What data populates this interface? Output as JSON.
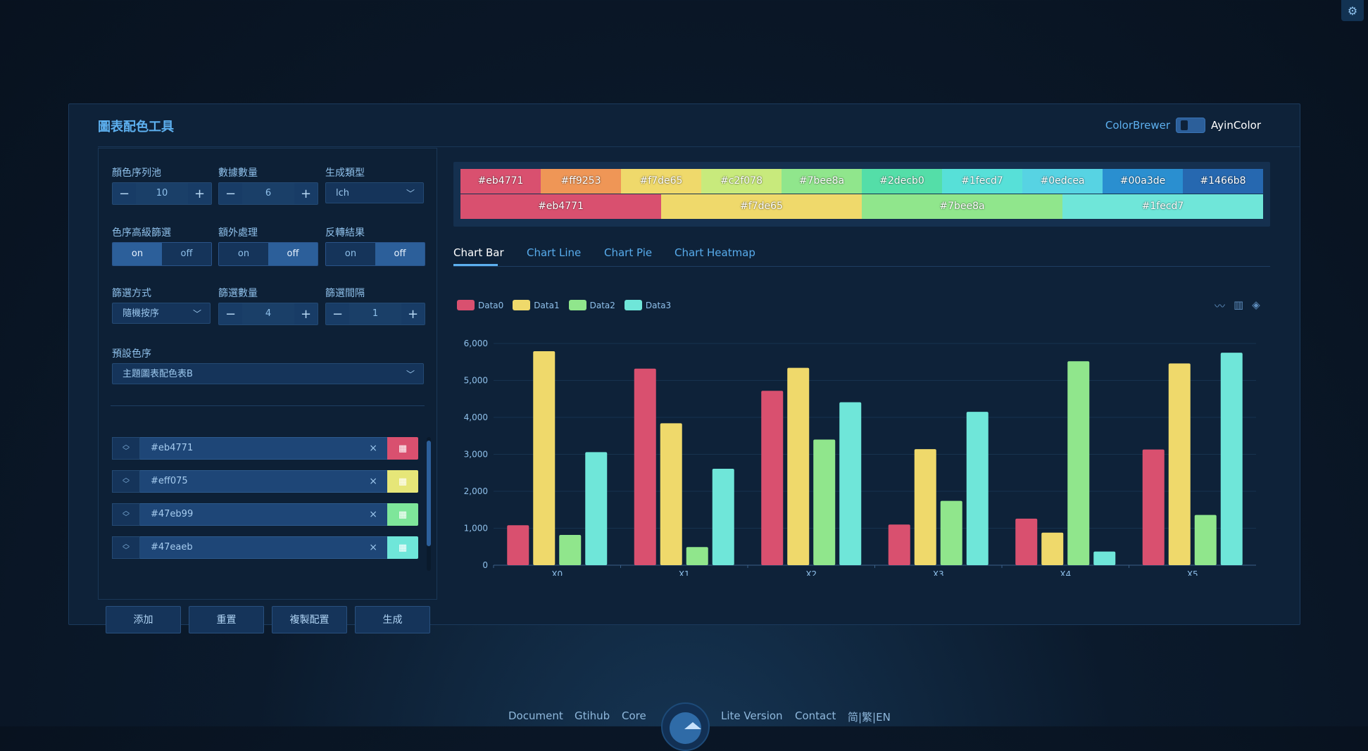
{
  "app": {
    "title": "圖表配色工具",
    "switch_left": "ColorBrewer",
    "switch_right": "AyinColor"
  },
  "controls": {
    "color_count_label": "顏色序列池",
    "color_count_value": "10",
    "data_count_label": "數據數量",
    "data_count_value": "6",
    "gen_type_label": "生成類型",
    "gen_type_value": "lch",
    "advanced_filter_label": "色序高級篩選",
    "extra_process_label": "額外處理",
    "reverse_label": "反轉結果",
    "on": "on",
    "off": "off",
    "advanced_filter_state": "on",
    "extra_process_state": "off",
    "reverse_state": "off",
    "filter_mode_label": "篩選方式",
    "filter_mode_value": "隨機按序",
    "filter_count_label": "篩選數量",
    "filter_count_value": "4",
    "filter_interval_label": "篩選間隔",
    "filter_interval_value": "1",
    "preset_label": "預設色序",
    "preset_value": "主題圖表配色表B"
  },
  "color_rows": [
    {
      "hex": "#eb4771",
      "color": "#d9506f"
    },
    {
      "hex": "#eff075",
      "color": "#e6e678"
    },
    {
      "hex": "#47eb99",
      "color": "#7ee69a"
    },
    {
      "hex": "#47eaeb",
      "color": "#6fe6d9"
    }
  ],
  "actions": {
    "add": "添加",
    "reset": "重置",
    "copy": "複製配置",
    "generate": "生成"
  },
  "palette_row1": [
    {
      "hex": "#eb4771",
      "color": "#d9506f"
    },
    {
      "hex": "#ff9253",
      "color": "#ef9656"
    },
    {
      "hex": "#f7de65",
      "color": "#efd96b"
    },
    {
      "hex": "#c2f078",
      "color": "#c8ea7c"
    },
    {
      "hex": "#7bee8a",
      "color": "#90e68c"
    },
    {
      "hex": "#2decb0",
      "color": "#54dea8"
    },
    {
      "hex": "#1fecd7",
      "color": "#57e0d8"
    },
    {
      "hex": "#0edcea",
      "color": "#57d3e3"
    },
    {
      "hex": "#00a3de",
      "color": "#2a8fd0"
    },
    {
      "hex": "#1466b8",
      "color": "#2668b0"
    }
  ],
  "palette_row2": [
    {
      "hex": "#eb4771",
      "color": "#d9506f"
    },
    {
      "hex": "#f7de65",
      "color": "#efd96b"
    },
    {
      "hex": "#7bee8a",
      "color": "#90e68c"
    },
    {
      "hex": "#1fecd7",
      "color": "#6fe6d9"
    }
  ],
  "tabs": [
    "Chart Bar",
    "Chart Line",
    "Chart Pie",
    "Chart Heatmap"
  ],
  "chart_data": {
    "type": "bar",
    "categories": [
      "X0",
      "X1",
      "X2",
      "X3",
      "X4",
      "X5"
    ],
    "series": [
      {
        "name": "Data0",
        "color": "#d9506f",
        "values": [
          1080,
          5320,
          4720,
          1100,
          1260,
          3130
        ]
      },
      {
        "name": "Data1",
        "color": "#efd96b",
        "values": [
          5790,
          3840,
          5340,
          3140,
          880,
          5460
        ]
      },
      {
        "name": "Data2",
        "color": "#90e68c",
        "values": [
          820,
          490,
          3400,
          1740,
          5520,
          1360
        ]
      },
      {
        "name": "Data3",
        "color": "#6fe6d9",
        "values": [
          3060,
          2610,
          4410,
          4150,
          370,
          5750
        ]
      }
    ],
    "yticks": [
      "0",
      "1,000",
      "2,000",
      "3,000",
      "4,000",
      "5,000",
      "6,000"
    ],
    "ylim": [
      0,
      6000
    ],
    "legend": "top-left",
    "grid": true
  },
  "footer": {
    "document": "Document",
    "github": "Gtihub",
    "core": "Core",
    "lite": "Lite Version",
    "contact": "Contact",
    "lang": "简|繁|EN"
  }
}
